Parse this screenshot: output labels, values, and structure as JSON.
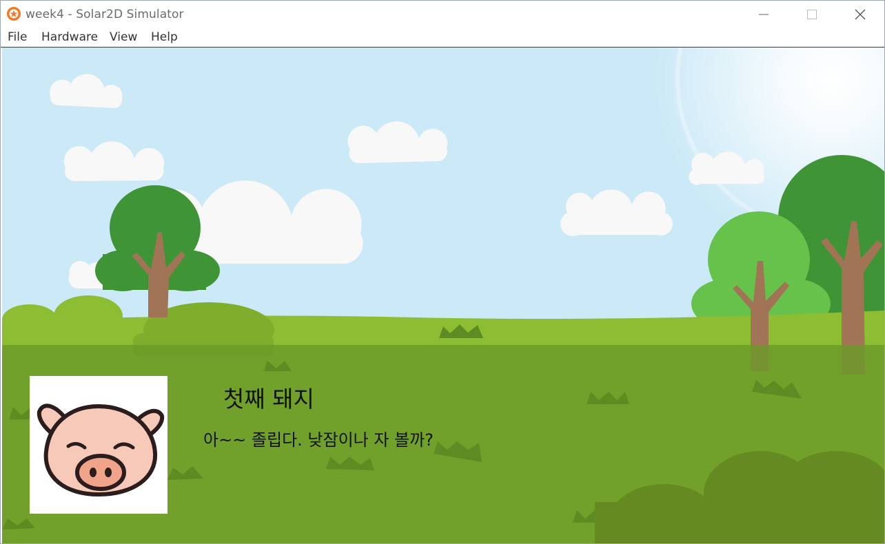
{
  "window": {
    "title": "week4 - Solar2D Simulator",
    "app_icon": "solar2d-logo-icon",
    "controls": [
      "minimize-icon",
      "maximize-icon",
      "close-icon"
    ]
  },
  "menu": [
    "File",
    "Hardware",
    "View",
    "Help"
  ],
  "dialog": {
    "speaker": "첫째 돼지",
    "text": "아~~ 졸립다. 낮잠이나 자 볼까?",
    "portrait": "pig-face-icon"
  },
  "colors": {
    "sky": "#cbe9f7",
    "grass": "#8cbd32",
    "dialog_overlay": "#6b9a2a",
    "tree_dark": "#3f9435",
    "tree_light": "#66c24a",
    "trunk": "#a07454",
    "pig_skin": "#f6c9b8",
    "pig_snout": "#f0a58b"
  }
}
